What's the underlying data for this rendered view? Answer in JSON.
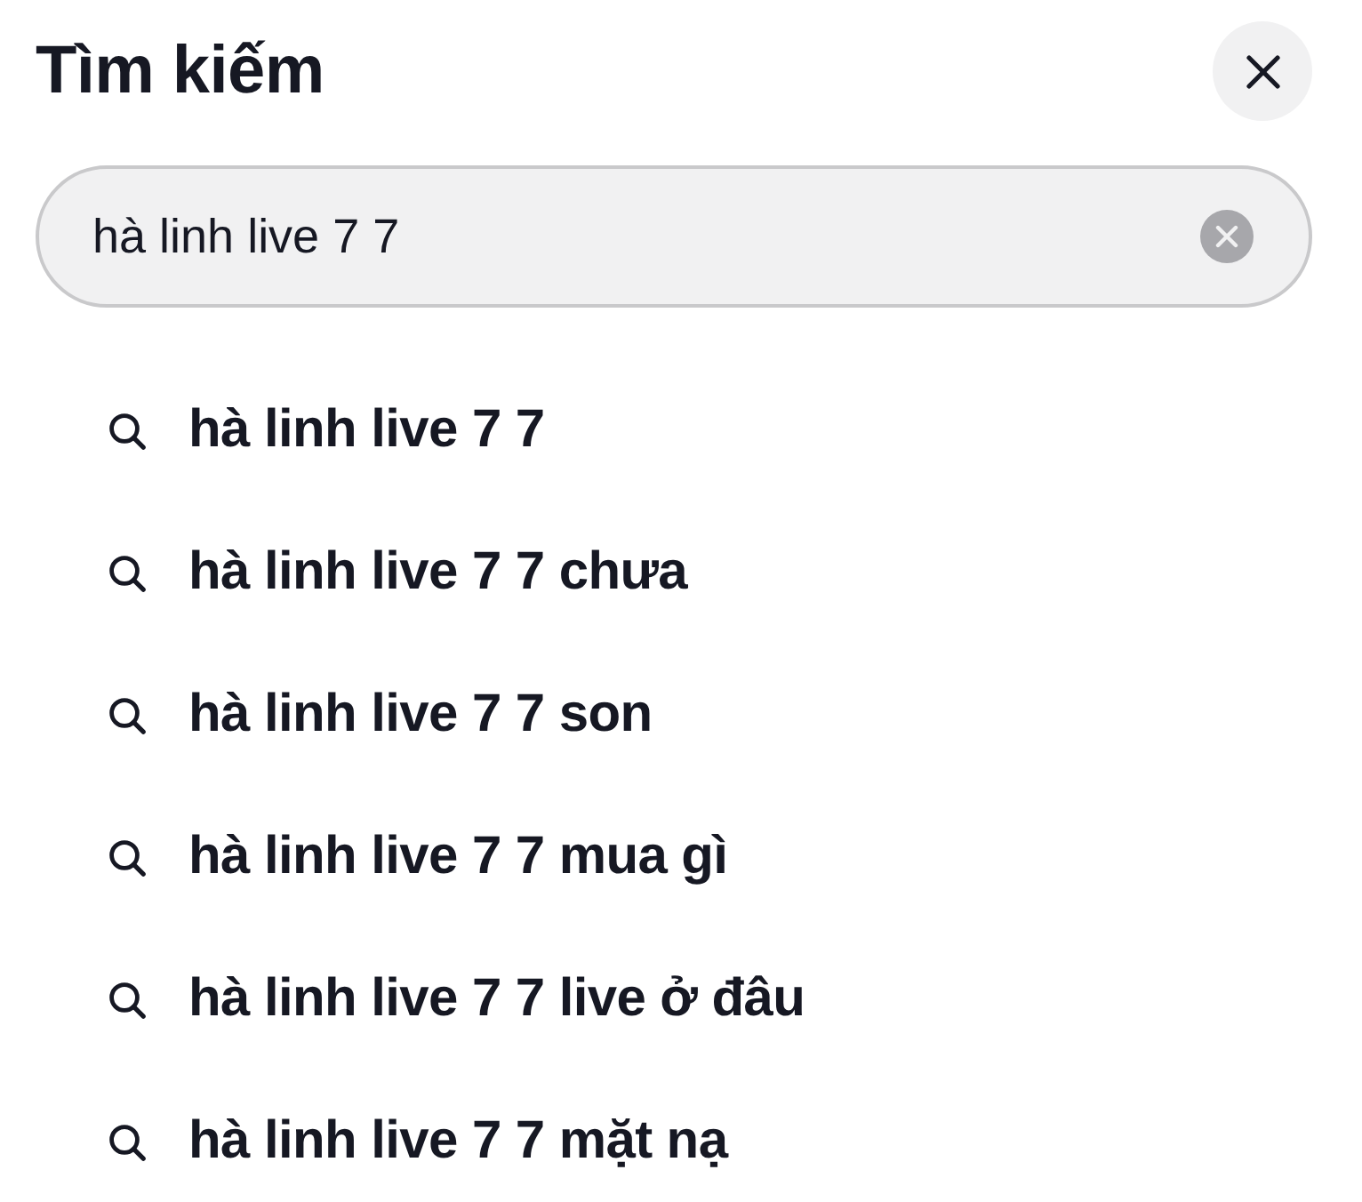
{
  "header": {
    "title": "Tìm kiếm"
  },
  "search": {
    "value": "hà linh live 7 7"
  },
  "suggestions": [
    {
      "text": "hà linh live 7 7"
    },
    {
      "text": "hà linh live 7 7 chưa"
    },
    {
      "text": "hà linh live 7 7 son"
    },
    {
      "text": "hà linh live 7 7 mua gì"
    },
    {
      "text": "hà linh live 7 7 live ở đâu"
    },
    {
      "text": "hà linh live 7 7 mặt nạ"
    }
  ]
}
